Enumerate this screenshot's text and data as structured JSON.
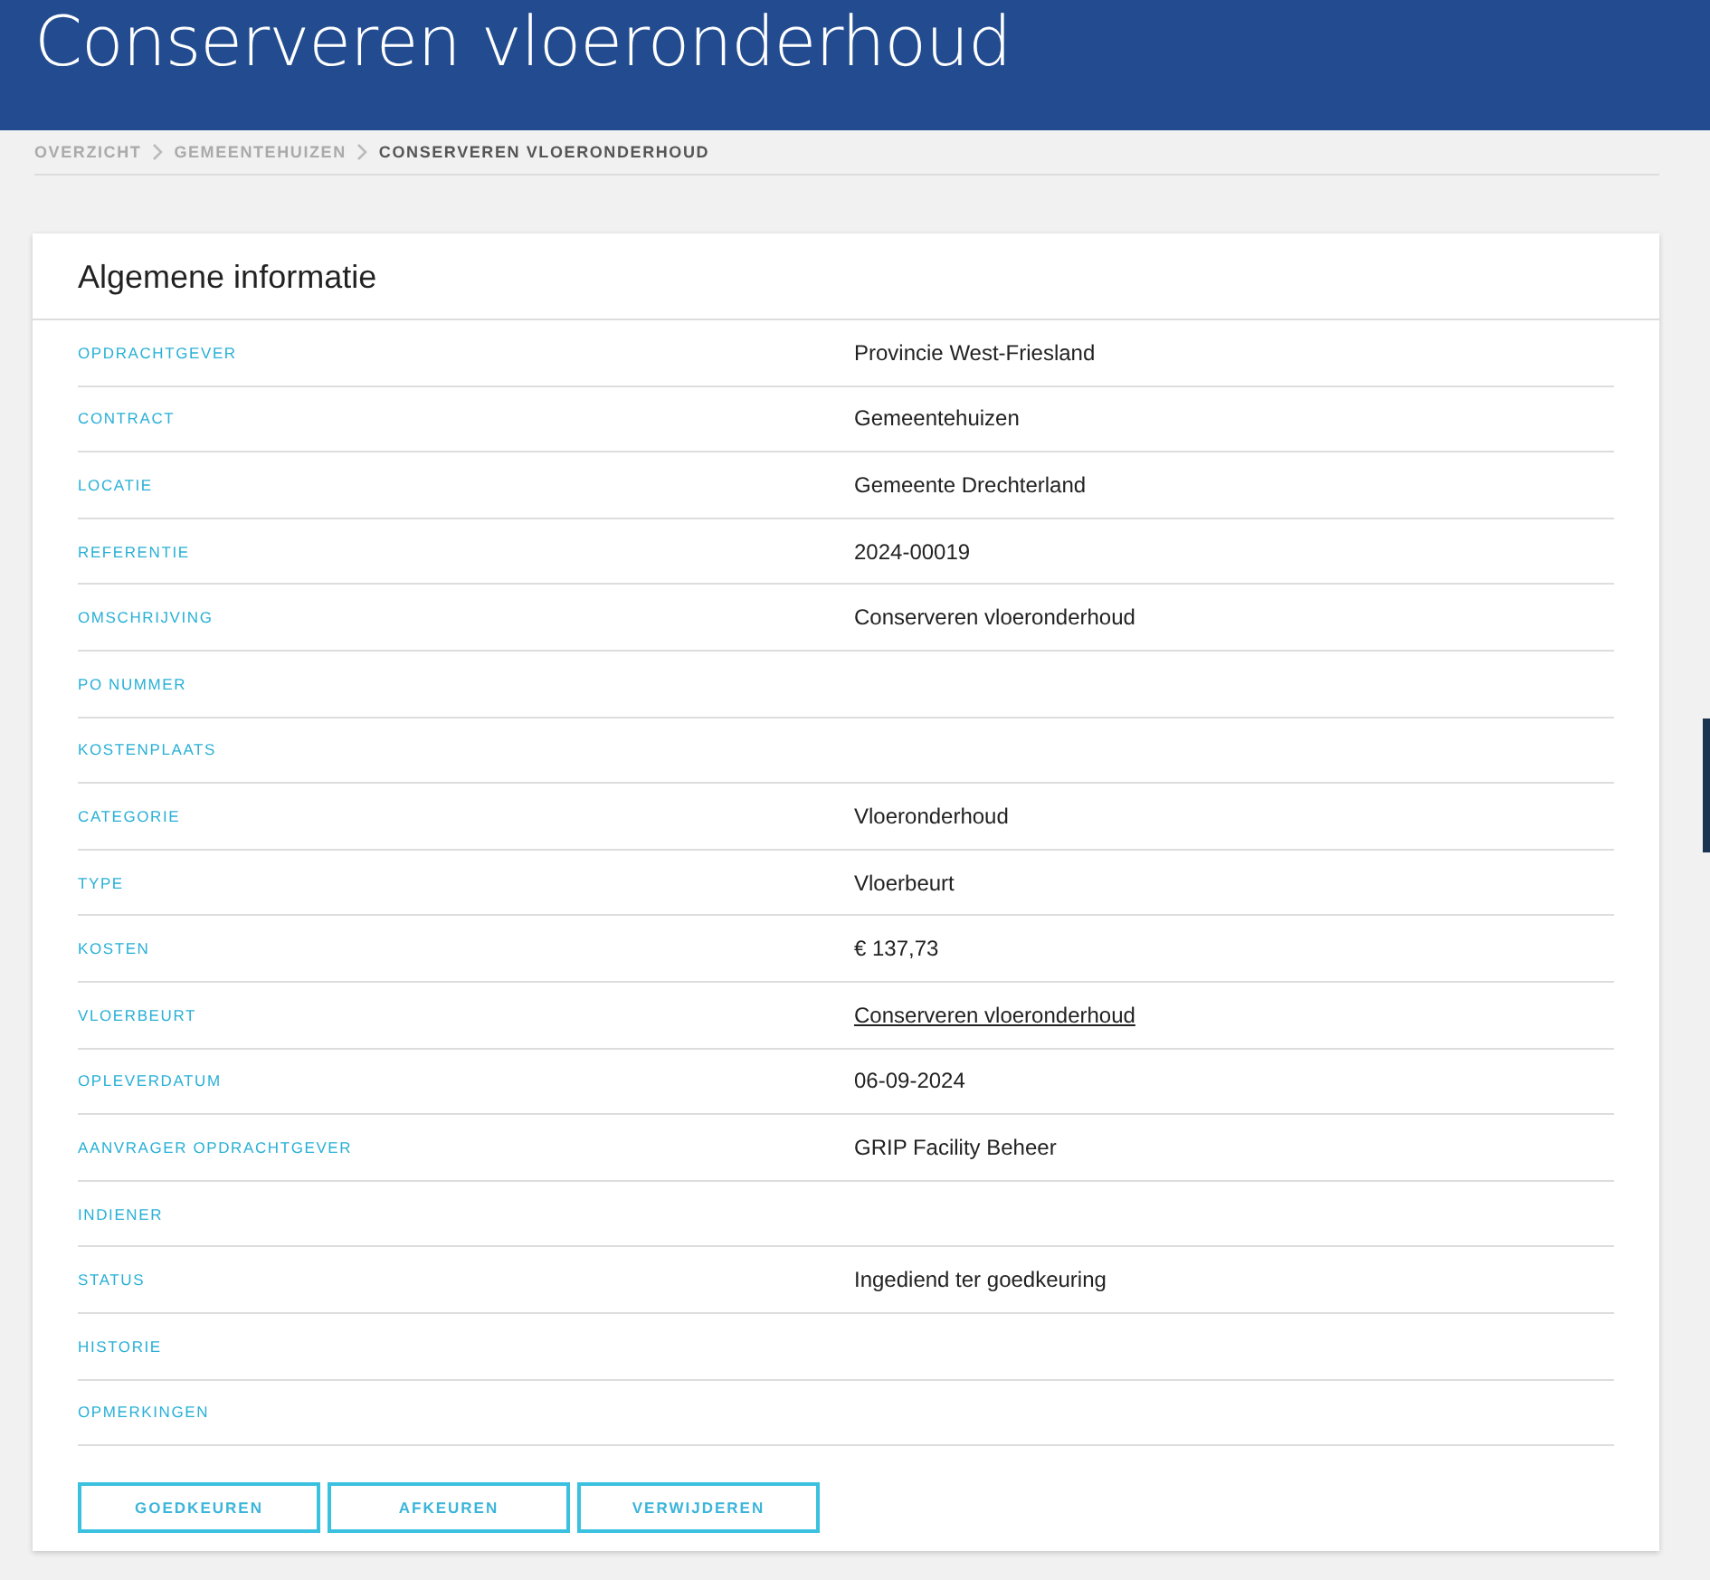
{
  "page": {
    "title": "Conserveren vloeronderhoud"
  },
  "breadcrumb": [
    {
      "label": "OVERZICHT",
      "selected": false
    },
    {
      "label": "GEMEENTEHUIZEN",
      "selected": false
    },
    {
      "label": "CONSERVEREN VLOERONDERHOUD",
      "selected": true
    }
  ],
  "card": {
    "title": "Algemene informatie",
    "rows": [
      {
        "label": "OPDRACHTGEVER",
        "value": "Provincie West-Friesland",
        "kind": "text"
      },
      {
        "label": "CONTRACT",
        "value": "Gemeentehuizen",
        "kind": "text"
      },
      {
        "label": "LOCATIE",
        "value": "Gemeente Drechterland",
        "kind": "text"
      },
      {
        "label": "REFERENTIE",
        "value": "2024-00019",
        "kind": "text"
      },
      {
        "label": "OMSCHRIJVING",
        "value": "Conserveren vloeronderhoud",
        "kind": "text"
      },
      {
        "label": "PO NUMMER"
      },
      {
        "label": "KOSTENPLAATS"
      },
      {
        "label": "CATEGORIE",
        "value": "Vloeronderhoud",
        "kind": "text"
      },
      {
        "label": "TYPE",
        "value": "Vloerbeurt",
        "kind": "text"
      },
      {
        "label": "KOSTEN",
        "value": "€ 137,73",
        "kind": "text"
      },
      {
        "label": "VLOERBEURT",
        "value": "Conserveren vloeronderhoud",
        "kind": "link"
      },
      {
        "label": "OPLEVERDATUM",
        "value": "06-09-2024",
        "kind": "text"
      },
      {
        "label": "AANVRAGER OPDRACHTGEVER",
        "value": "GRIP Facility Beheer",
        "kind": "text"
      },
      {
        "label": "INDIENER"
      },
      {
        "label": "STATUS",
        "value": "Ingediend ter goedkeuring",
        "kind": "text"
      },
      {
        "label": "HISTORIE"
      },
      {
        "label": "OPMERKINGEN"
      }
    ],
    "buttons": [
      "GOEDKEUREN",
      "AFKEUREN",
      "VERWIJDEREN"
    ]
  }
}
